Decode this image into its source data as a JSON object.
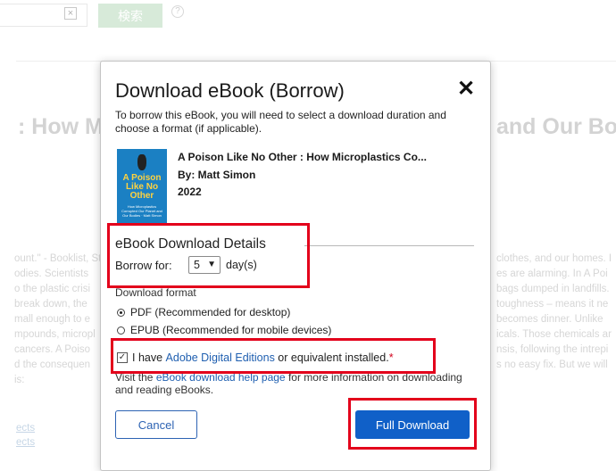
{
  "background": {
    "search_clear": "×",
    "search_button": "検索",
    "help_glyph": "?",
    "title_left": ": How M",
    "title_right": "and Our Bo",
    "desc_left": [
      "ount.\" - Booklist, St",
      "odies. Scientists",
      "o the plastic crisi",
      " break down, the",
      "mall enough to e",
      "mpounds, micropl",
      " cancers. A Poiso",
      "d the consequen",
      "is:"
    ],
    "desc_right": [
      "clothes, and our homes. I",
      "es are alarming. In A Poi",
      "bags dumped in landfills.",
      "toughness – means it ne",
      "becomes dinner. Unlike",
      "icals. Those chemicals ar",
      "nsis, following the intrepi",
      "s no easy fix. But we will",
      ""
    ],
    "links": [
      "ects",
      "ects"
    ]
  },
  "modal": {
    "title": "Download eBook (Borrow)",
    "close_glyph": "✕",
    "intro": "To borrow this eBook, you will need to select a download duration and choose a format (if applicable).",
    "book": {
      "cover_text": "A Poison Like No Other",
      "cover_subtitle": "How Microplastics Corrupted Our Planet and Our Bodies · Matt Simon",
      "title": "A Poison Like No Other : How Microplastics Co...",
      "author": "By: Matt Simon",
      "year": "2022"
    },
    "details_heading": "eBook Download Details",
    "borrow_label": "Borrow for:",
    "borrow_value": "5",
    "borrow_unit": "day(s)",
    "format_label": "Download format",
    "formats": [
      {
        "label": "PDF (Recommended for desktop)",
        "checked": true
      },
      {
        "label": "EPUB (Recommended for mobile devices)",
        "checked": false
      }
    ],
    "agree_prefix": "I have ",
    "agree_link": "Adobe Digital Editions",
    "agree_suffix": " or equivalent installed.",
    "agree_required": "*",
    "agree_checked": true,
    "help_prefix": "Visit the ",
    "help_link": "eBook download help page",
    "help_suffix": " for more information on downloading and reading eBooks.",
    "cancel_label": "Cancel",
    "download_label": "Full Download"
  },
  "colors": {
    "primary_button": "#1060c8",
    "link": "#1f5fb0",
    "highlight": "#e3001b"
  }
}
